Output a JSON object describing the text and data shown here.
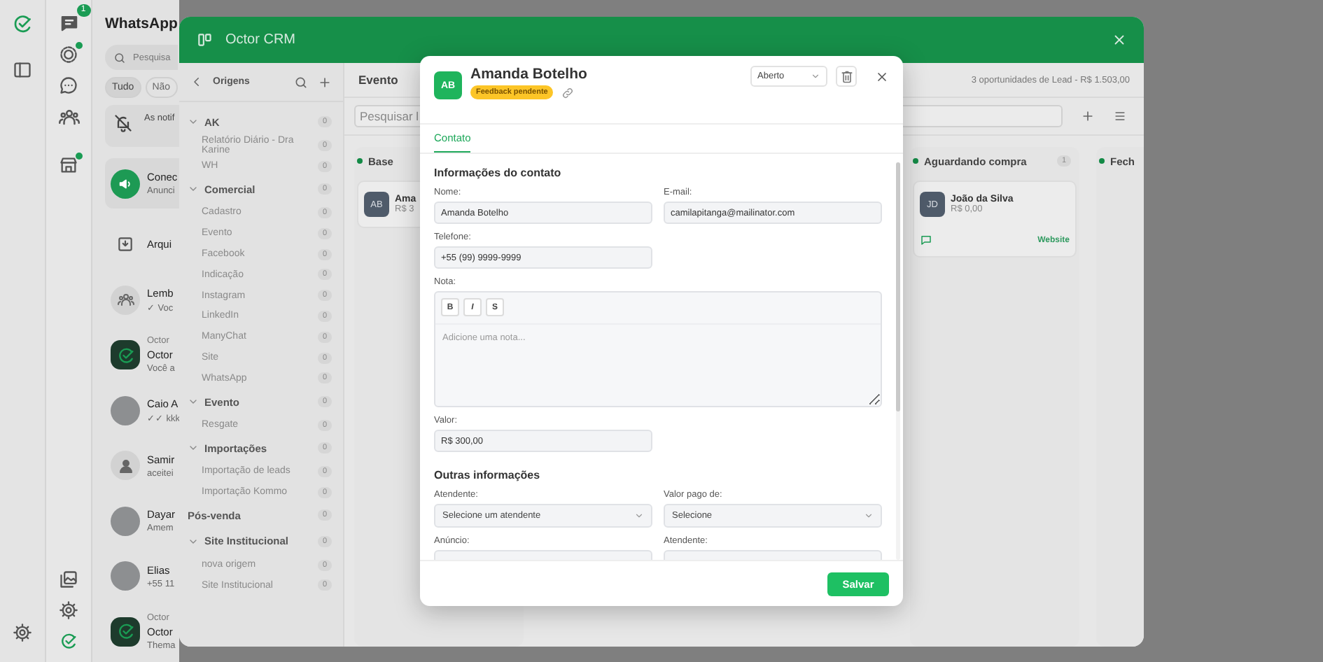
{
  "app": {
    "title": "WhatsApp",
    "unread_badge": "1",
    "search": {
      "placeholder": "Pesquisa"
    },
    "filters": [
      {
        "label": "Tudo",
        "selected": true
      },
      {
        "label": "Não",
        "selected": false
      }
    ],
    "notice": {
      "text": "As notif"
    },
    "chats": [
      {
        "kind": "announce",
        "name": "Conec",
        "preview": "Anunci",
        "selected": true
      },
      {
        "kind": "archive",
        "name": "Arqui",
        "selected": false
      },
      {
        "kind": "group",
        "name": "Lemb",
        "preview": "✓ Voc",
        "selected": false
      },
      {
        "kind": "octor",
        "label": "Octor",
        "name": "Octor",
        "preview": "Você a",
        "selected": false
      },
      {
        "kind": "photo",
        "name": "Caio A",
        "preview": "✓✓ kkk",
        "selected": false
      },
      {
        "kind": "person",
        "name": "Samir",
        "preview": "aceitei",
        "selected": false
      },
      {
        "kind": "photo",
        "name": "Dayar",
        "preview": "Amem",
        "selected": false
      },
      {
        "kind": "photo",
        "name": "Elias",
        "preview": "+55 11",
        "selected": false
      },
      {
        "kind": "octor",
        "label": "Octor",
        "name": "Octor",
        "preview": "Thema",
        "selected": false
      }
    ]
  },
  "crm": {
    "title": "Octor CRM",
    "sidebar": {
      "title": "Origens",
      "items": [
        {
          "label": "AK",
          "count": "0",
          "expanded": true,
          "children": [
            {
              "label": "Relatório Diário - Dra Karine",
              "count": "0"
            },
            {
              "label": "WH",
              "count": "0"
            }
          ]
        },
        {
          "label": "Comercial",
          "count": "0",
          "expanded": true,
          "children": [
            {
              "label": "Cadastro",
              "count": "0"
            },
            {
              "label": "Evento",
              "count": "0"
            },
            {
              "label": "Facebook",
              "count": "0"
            },
            {
              "label": "Indicação",
              "count": "0"
            },
            {
              "label": "Instagram",
              "count": "0"
            },
            {
              "label": "LinkedIn",
              "count": "0"
            },
            {
              "label": "ManyChat",
              "count": "0"
            },
            {
              "label": "Site",
              "count": "0"
            },
            {
              "label": "WhatsApp",
              "count": "0"
            }
          ]
        },
        {
          "label": "Evento",
          "count": "0",
          "expanded": true,
          "children": [
            {
              "label": "Resgate",
              "count": "0"
            }
          ]
        },
        {
          "label": "Importações",
          "count": "0",
          "expanded": true,
          "children": [
            {
              "label": "Importação de leads",
              "count": "0"
            },
            {
              "label": "Importação Kommo",
              "count": "0"
            }
          ]
        },
        {
          "label": "Pós-venda",
          "count": "0"
        },
        {
          "label": "Site Institucional",
          "count": "0",
          "expanded": true,
          "children": [
            {
              "label": "nova origem",
              "count": "0"
            },
            {
              "label": "Site Institucional",
              "count": "0"
            }
          ]
        }
      ]
    },
    "board": {
      "title": "Evento",
      "summary": "3 oportunidades de Lead - R$ 1.503,00",
      "search": {
        "placeholder": "Pesquisar l"
      },
      "columns": [
        {
          "title": "Base",
          "cards": [
            {
              "initials": "AB",
              "name": "Ama",
              "value": "R$ 3"
            }
          ]
        },
        {
          "title": "Aguardando compra",
          "count": "1",
          "cards": [
            {
              "initials": "JD",
              "name": "João da Silva",
              "value": "R$ 0,00",
              "tag": "Website"
            }
          ]
        },
        {
          "title": "Fech"
        }
      ]
    }
  },
  "modal": {
    "initials": "AB",
    "name": "Amanda Botelho",
    "badge": "Feedback pendente",
    "status": "Aberto",
    "tabs": [
      {
        "label": "Contato",
        "selected": true
      }
    ],
    "sections": [
      {
        "title": "Informações do contato",
        "fields": [
          {
            "kind": "text",
            "label": "Nome:",
            "value": "Amanda Botelho"
          },
          {
            "kind": "text",
            "label": "E-mail:",
            "value": "camilapitanga@mailinator.com"
          },
          {
            "kind": "text",
            "label": "Telefone:",
            "value": "+55 (99) 9999-9999"
          },
          {
            "kind": "note",
            "label": "Nota:",
            "tools": [
              "B",
              "I",
              "S"
            ],
            "placeholder": "Adicione uma nota..."
          },
          {
            "kind": "text",
            "label": "Valor:",
            "value": "R$ 300,00"
          }
        ]
      },
      {
        "title": "Outras informações",
        "fields": [
          {
            "kind": "select",
            "label": "Atendente:",
            "value": "Selecione um atendente"
          },
          {
            "kind": "select",
            "label": "Valor pago de:",
            "value": "Selecione"
          },
          {
            "kind": "text",
            "label": "Anúncio:"
          },
          {
            "kind": "text",
            "label": "Atendente:"
          }
        ]
      }
    ],
    "save_button": "Salvar"
  }
}
